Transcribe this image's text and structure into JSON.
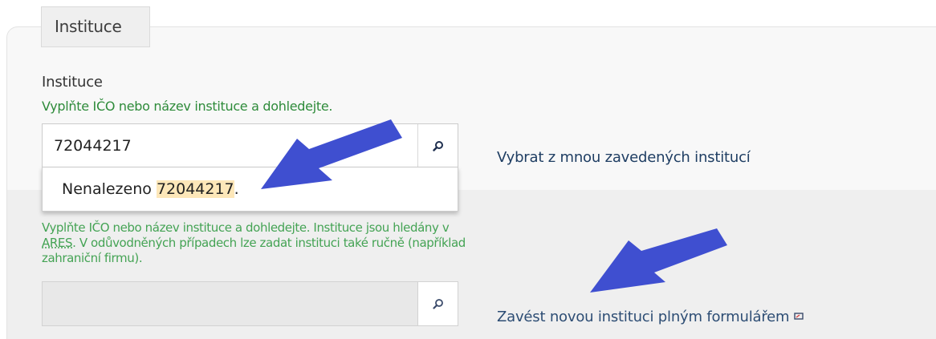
{
  "section": {
    "legend": "Instituce"
  },
  "institution_field": {
    "label": "Instituce",
    "hint": "Vyplňte IČO nebo název instituce a dohledejte.",
    "value": "72044217",
    "dropdown": {
      "prefix": "Nenalezeno ",
      "match": "72044217",
      "suffix": "."
    }
  },
  "links": {
    "select_existing": "Vybrat z mnou zavedených institucí",
    "create_new": "Zavést novou instituci plným formulářem"
  },
  "second_field": {
    "help_part1": "Vyplňte IČO nebo název instituce a dohledejte. Instituce jsou hledány v ",
    "help_link": "ARES",
    "help_part2": ". V odůvodněných případech lze zadat instituci také ručně (například zahraniční firmu).",
    "value": ""
  },
  "icons": {
    "search": "search-icon",
    "external": "external-link-icon",
    "annotation_arrow": "arrow-annotation"
  },
  "colors": {
    "hint_green": "#2e8b3a",
    "link_blue": "#1f3e63",
    "highlight": "#fde7b9",
    "arrow_blue": "#3f4fd0"
  }
}
